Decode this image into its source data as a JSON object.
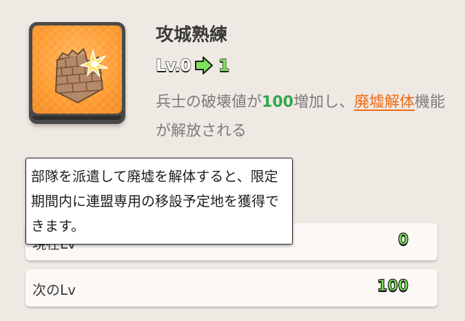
{
  "skill": {
    "name": "攻城熟練",
    "icon": "crumbling-brick-wall-icon",
    "level_prefix": "Lv.0",
    "level_next": "1",
    "desc_part1": "兵士の破壊値が",
    "desc_number": "100",
    "desc_part2": "増加し、",
    "desc_link": "廃墟解体",
    "desc_part3": "機能が解放される"
  },
  "tooltip": {
    "text": "部隊を派遣して廃墟を解体すると、限定期間内に連盟専用の移設予定地を獲得できます。"
  },
  "stats": {
    "current_label": "現在Lv",
    "current_value": "0",
    "next_label": "次のLv",
    "next_value": "100"
  },
  "colors": {
    "background": "#efe9e4",
    "highlight_number": "#34a64a",
    "link": "#ef6a12",
    "value_green": "#7ce05a",
    "icon_bg": "#ff9a2e"
  }
}
